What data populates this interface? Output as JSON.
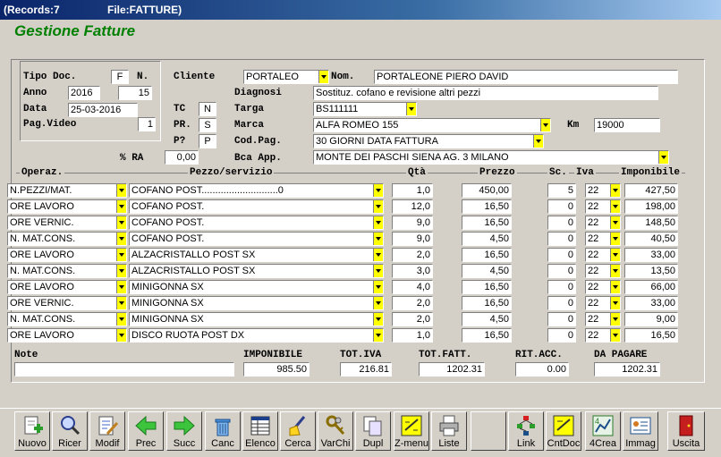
{
  "window": {
    "records": "(Records:7",
    "file": "File:FATTURE)"
  },
  "app_title": "Gestione Fatture",
  "header": {
    "tipo_doc_label": "Tipo Doc.",
    "tipo_doc_value": "F",
    "n_label": "N.",
    "anno_label": "Anno",
    "anno_value": "2016",
    "n_value": "15",
    "data_label": "Data",
    "data_value": "25-03-2016",
    "pag_video_label": "Pag.Video",
    "pag_video_value": "1",
    "cliente_label": "Cliente",
    "cliente_value": "PORTALEO",
    "nom_label": "Nom.",
    "nom_value": "PORTALEONE PIERO DAVID",
    "diagnosi_label": "Diagnosi",
    "diagnosi_value": "Sostituz. cofano e revisione altri pezzi",
    "tc_label": "TC",
    "tc_value": "N",
    "targa_label": "Targa",
    "targa_value": "BS111111",
    "pr_label": "PR.",
    "pr_value": "S",
    "marca_label": "Marca",
    "marca_value": "ALFA ROMEO 155",
    "km_label": "Km",
    "km_value": "19000",
    "pq_label": "P?",
    "pq_value": "P",
    "codpag_label": "Cod.Pag.",
    "codpag_value": "30 GIORNI DATA FATTURA",
    "ra_label": "% RA",
    "ra_value": "0,00",
    "bca_label": "Bca App.",
    "bca_value": "MONTE DEI PASCHI SIENA   AG. 3   MILANO"
  },
  "columns": {
    "operaz": "Operaz.",
    "pezzo": "Pezzo/servizio",
    "qta": "Qtà",
    "prezzo": "Prezzo",
    "sc": "Sc.",
    "iva": "Iva",
    "imponibile": "Imponibile"
  },
  "rows": [
    {
      "operaz": "N.PEZZI/MAT.",
      "pezzo": "COFANO POST............................0",
      "qta": "1,0",
      "prezzo": "450,00",
      "sc": "5",
      "iva": "22",
      "imponibile": "427,50"
    },
    {
      "operaz": "ORE LAVORO",
      "pezzo": "COFANO POST.",
      "qta": "12,0",
      "prezzo": "16,50",
      "sc": "0",
      "iva": "22",
      "imponibile": "198,00"
    },
    {
      "operaz": "ORE VERNIC.",
      "pezzo": "COFANO POST.",
      "qta": "9,0",
      "prezzo": "16,50",
      "sc": "0",
      "iva": "22",
      "imponibile": "148,50"
    },
    {
      "operaz": "N. MAT.CONS.",
      "pezzo": "COFANO POST.",
      "qta": "9,0",
      "prezzo": "4,50",
      "sc": "0",
      "iva": "22",
      "imponibile": "40,50"
    },
    {
      "operaz": "ORE LAVORO",
      "pezzo": "ALZACRISTALLO POST SX",
      "qta": "2,0",
      "prezzo": "16,50",
      "sc": "0",
      "iva": "22",
      "imponibile": "33,00"
    },
    {
      "operaz": "N. MAT.CONS.",
      "pezzo": "ALZACRISTALLO POST SX",
      "qta": "3,0",
      "prezzo": "4,50",
      "sc": "0",
      "iva": "22",
      "imponibile": "13,50"
    },
    {
      "operaz": "ORE LAVORO",
      "pezzo": "MINIGONNA SX",
      "qta": "4,0",
      "prezzo": "16,50",
      "sc": "0",
      "iva": "22",
      "imponibile": "66,00"
    },
    {
      "operaz": "ORE VERNIC.",
      "pezzo": "MINIGONNA SX",
      "qta": "2,0",
      "prezzo": "16,50",
      "sc": "0",
      "iva": "22",
      "imponibile": "33,00"
    },
    {
      "operaz": "N. MAT.CONS.",
      "pezzo": "MINIGONNA SX",
      "qta": "2,0",
      "prezzo": "4,50",
      "sc": "0",
      "iva": "22",
      "imponibile": "9,00"
    },
    {
      "operaz": "ORE LAVORO",
      "pezzo": "DISCO RUOTA POST DX",
      "qta": "1,0",
      "prezzo": "16,50",
      "sc": "0",
      "iva": "22",
      "imponibile": "16,50"
    }
  ],
  "totals": {
    "note_label": "Note",
    "note_value": "",
    "imponibile_label": "IMPONIBILE",
    "imponibile_value": "985.50",
    "tot_iva_label": "TOT.IVA",
    "tot_iva_value": "216.81",
    "tot_fatt_label": "TOT.FATT.",
    "tot_fatt_value": "1202.31",
    "rit_acc_label": "RIT.ACC.",
    "rit_acc_value": "0.00",
    "da_pagare_label": "DA PAGARE",
    "da_pagare_value": "1202.31"
  },
  "toolbar": [
    {
      "id": "nuovo",
      "label": "Nuovo",
      "icon": "new-document-icon"
    },
    {
      "id": "ricer",
      "label": "Ricer",
      "icon": "magnifier-icon"
    },
    {
      "id": "modif",
      "label": "Modif",
      "icon": "edit-document-icon"
    },
    {
      "id": "prec",
      "label": "Prec",
      "icon": "arrow-left-icon"
    },
    {
      "id": "succ",
      "label": "Succ",
      "icon": "arrow-right-icon"
    },
    {
      "id": "canc",
      "label": "Canc",
      "icon": "trash-icon"
    },
    {
      "id": "elenco",
      "label": "Elenco",
      "icon": "list-table-icon"
    },
    {
      "id": "cerca",
      "label": "Cerca",
      "icon": "broom-search-icon"
    },
    {
      "id": "varchi",
      "label": "VarChi",
      "icon": "keys-icon"
    },
    {
      "id": "dupl",
      "label": "Dupl",
      "icon": "duplicate-icon"
    },
    {
      "id": "zmenu",
      "label": "Z-menu",
      "icon": "menu-grid-icon"
    },
    {
      "id": "liste",
      "label": "Liste",
      "icon": "printer-icon"
    },
    {
      "id": "blank",
      "label": "",
      "icon": ""
    },
    {
      "id": "link",
      "label": "Link",
      "icon": "link-tree-icon"
    },
    {
      "id": "cntdoc",
      "label": "CntDoc",
      "icon": "counter-doc-icon"
    },
    {
      "id": "4crea",
      "label": "4Crea",
      "icon": "create-chart-icon"
    },
    {
      "id": "immag",
      "label": "Immag",
      "icon": "image-card-icon"
    },
    {
      "id": "uscita",
      "label": "Uscita",
      "icon": "exit-door-icon"
    }
  ],
  "colors": {
    "accent_title": "#008000",
    "dropdown": "#ffff00",
    "titlebar": "#0a246a"
  }
}
